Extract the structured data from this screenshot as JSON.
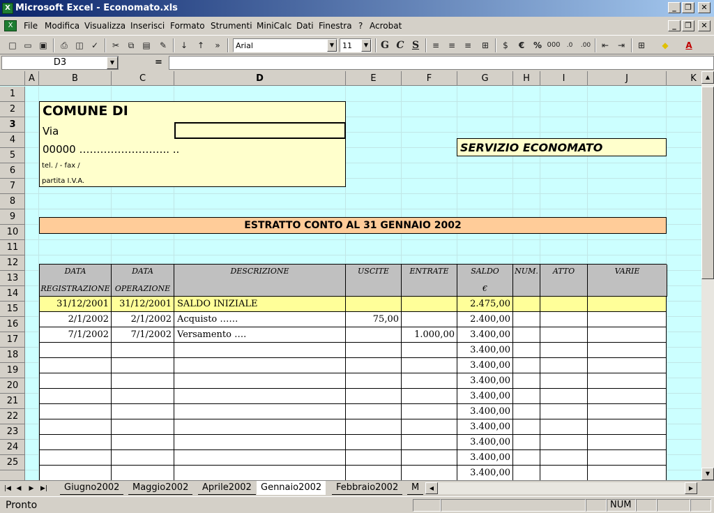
{
  "window": {
    "title": "Microsoft Excel - Economato.xls",
    "app_icon": "excel-icon"
  },
  "menu": [
    "File",
    "Modifica",
    "Visualizza",
    "Inserisci",
    "Formato",
    "Strumenti",
    "MiniCalc",
    "Dati",
    "Finestra",
    "?",
    "Acrobat"
  ],
  "toolbar": {
    "font": "Arial",
    "size": "11",
    "bold": "G",
    "italic": "C",
    "underline": "S",
    "euro": "€",
    "percent": "%",
    "thousands": "000"
  },
  "formula": {
    "cell_ref": "D3",
    "equals": "="
  },
  "columns": [
    "A",
    "B",
    "C",
    "D",
    "E",
    "F",
    "G",
    "H",
    "I",
    "J",
    "K"
  ],
  "rows": [
    "1",
    "2",
    "3",
    "4",
    "5",
    "6",
    "7",
    "8",
    "9",
    "10",
    "11",
    "12",
    "13",
    "14",
    "15",
    "16",
    "17",
    "18",
    "19",
    "20",
    "21",
    "22",
    "23",
    "24",
    "25"
  ],
  "header_box": {
    "comune": "COMUNE DI",
    "via": "Via",
    "cap": "00000 ……………………..  ..",
    "tel": "tel.          /            - fax          /",
    "piva": "partita I.V.A."
  },
  "servizio": "SERVIZIO ECONOMATO",
  "estratto": "ESTRATTO CONTO AL 31 GENNAIO 2002",
  "table": {
    "headers": [
      {
        "l1": "DATA",
        "l2": "REGISTRAZIONE"
      },
      {
        "l1": "DATA",
        "l2": "OPERAZIONE"
      },
      {
        "l1": "DESCRIZIONE",
        "l2": ""
      },
      {
        "l1": "USCITE",
        "l2": ""
      },
      {
        "l1": "ENTRATE",
        "l2": ""
      },
      {
        "l1": "SALDO",
        "l2": "€"
      },
      {
        "l1": "NUM.",
        "l2": ""
      },
      {
        "l1": "ATTO",
        "l2": ""
      },
      {
        "l1": "VARIE",
        "l2": ""
      }
    ],
    "rows": [
      {
        "reg": "31/12/2001",
        "op": "31/12/2001",
        "desc": "SALDO INIZIALE",
        "uscite": "",
        "entrate": "",
        "saldo": "2.475,00"
      },
      {
        "reg": "2/1/2002",
        "op": "2/1/2002",
        "desc": "Acquisto ……",
        "uscite": "75,00",
        "entrate": "",
        "saldo": "2.400,00"
      },
      {
        "reg": "7/1/2002",
        "op": "7/1/2002",
        "desc": "Versamento ….",
        "uscite": "",
        "entrate": "1.000,00",
        "saldo": "3.400,00"
      },
      {
        "reg": "",
        "op": "",
        "desc": "",
        "uscite": "",
        "entrate": "",
        "saldo": "3.400,00"
      },
      {
        "reg": "",
        "op": "",
        "desc": "",
        "uscite": "",
        "entrate": "",
        "saldo": "3.400,00"
      },
      {
        "reg": "",
        "op": "",
        "desc": "",
        "uscite": "",
        "entrate": "",
        "saldo": "3.400,00"
      },
      {
        "reg": "",
        "op": "",
        "desc": "",
        "uscite": "",
        "entrate": "",
        "saldo": "3.400,00"
      },
      {
        "reg": "",
        "op": "",
        "desc": "",
        "uscite": "",
        "entrate": "",
        "saldo": "3.400,00"
      },
      {
        "reg": "",
        "op": "",
        "desc": "",
        "uscite": "",
        "entrate": "",
        "saldo": "3.400,00"
      },
      {
        "reg": "",
        "op": "",
        "desc": "",
        "uscite": "",
        "entrate": "",
        "saldo": "3.400,00"
      },
      {
        "reg": "",
        "op": "",
        "desc": "",
        "uscite": "",
        "entrate": "",
        "saldo": "3.400,00"
      },
      {
        "reg": "",
        "op": "",
        "desc": "",
        "uscite": "",
        "entrate": "",
        "saldo": "3.400,00"
      }
    ]
  },
  "sheet_tabs": [
    "Giugno2002",
    "Maggio2002",
    "Aprile2002",
    "Gennaio2002",
    "Febbraio2002",
    "M"
  ],
  "active_tab": "Gennaio2002",
  "status": {
    "text": "Pronto",
    "num": "NUM"
  },
  "colors": {
    "sheet_bg": "#ccffff",
    "box_yellow": "#ffffcc",
    "estratto_orange": "#ffcc99",
    "row_highlight": "#ffff99",
    "title_blue": "#0a246a"
  }
}
